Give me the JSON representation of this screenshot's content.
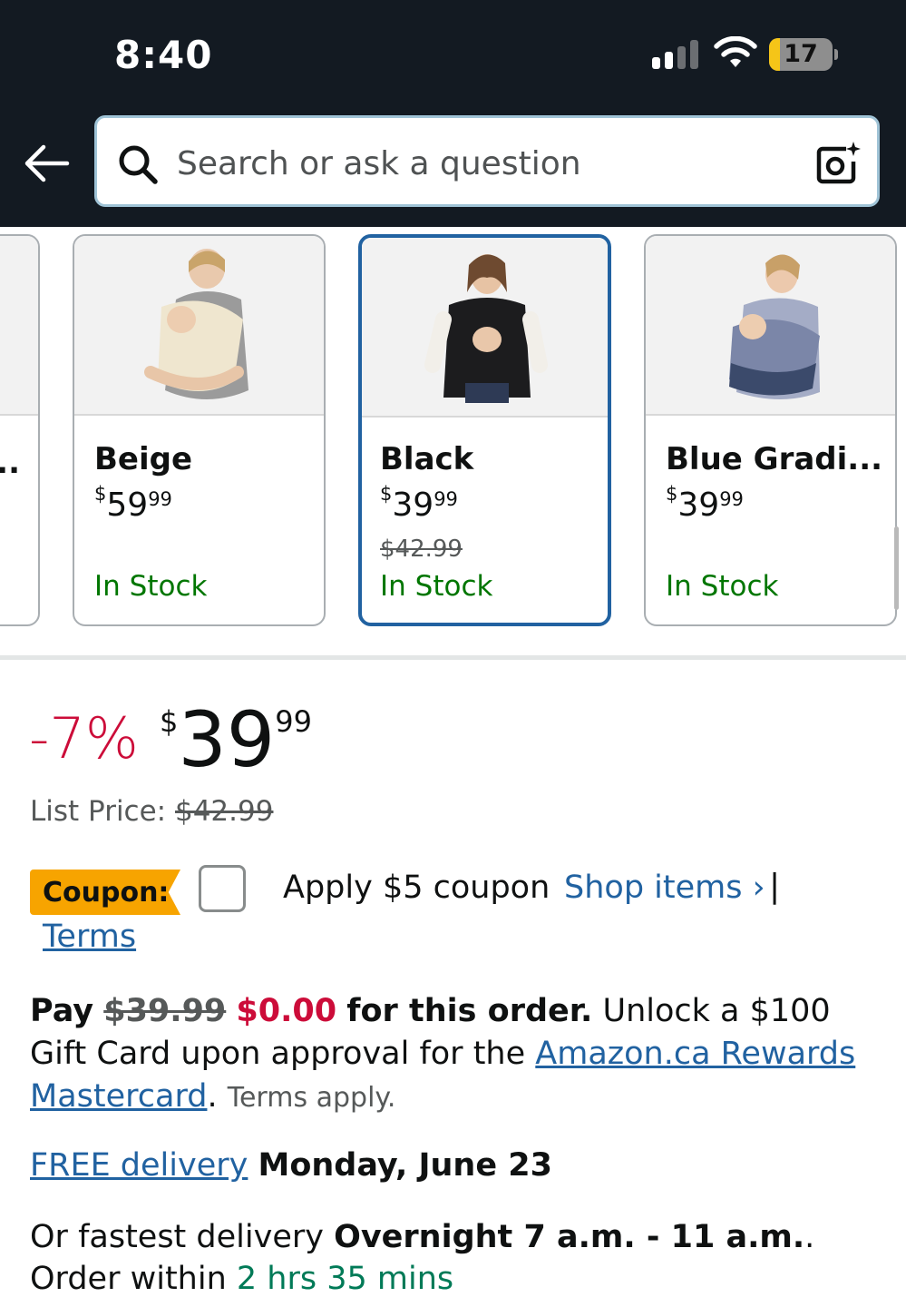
{
  "status_bar": {
    "time": "8:40",
    "battery_level": "17",
    "battery_percent": 17
  },
  "header": {
    "search_placeholder": "Search or ask a question",
    "icons": [
      "back-arrow-icon",
      "search-icon",
      "camera-icon"
    ]
  },
  "variants": {
    "partial_label": "..",
    "items": [
      {
        "name": "Beige",
        "price_currency": "$",
        "price_whole": "59",
        "price_fraction": "99",
        "list_price": "",
        "stock": "In Stock",
        "selected": false
      },
      {
        "name": "Black",
        "price_currency": "$",
        "price_whole": "39",
        "price_fraction": "99",
        "list_price": "$42.99",
        "stock": "In Stock",
        "selected": true
      },
      {
        "name": "Blue Gradi...",
        "price_currency": "$",
        "price_whole": "39",
        "price_fraction": "99",
        "list_price": "",
        "stock": "In Stock",
        "selected": false
      }
    ]
  },
  "price": {
    "discount": "-7%",
    "currency": "$",
    "whole": "39",
    "fraction": "99",
    "list_price_label": "List Price:",
    "list_price_value": "$42.99"
  },
  "coupon": {
    "badge": "Coupon:",
    "apply_text": "Apply $5 coupon",
    "shop_items": "Shop items ›",
    "separator": "|",
    "terms": "Terms"
  },
  "promo": {
    "pay": "Pay",
    "old_price": "$39.99",
    "new_price": "$0.00",
    "for_order": "for this order.",
    "unlock": "Unlock a $100 Gift Card upon approval for the",
    "card_link": "Amazon.ca Rewards Mastercard",
    "period": ".",
    "terms_apply": "Terms apply."
  },
  "delivery": {
    "free_link": "FREE delivery",
    "date": "Monday, June 23"
  },
  "fastest": {
    "prefix": "Or fastest delivery",
    "window": "Overnight 7 a.m. - 11 a.m.",
    "middle": ". Order within",
    "countdown": "2 hrs 35 mins"
  },
  "colors": {
    "header_bg": "#131a22",
    "link_blue": "#2162a1",
    "deal_red": "#cc0c39",
    "stock_green": "#007600",
    "coupon_orange": "#f7a400",
    "countdown_green": "#007a57",
    "battery_yellow": "#f5c518"
  }
}
